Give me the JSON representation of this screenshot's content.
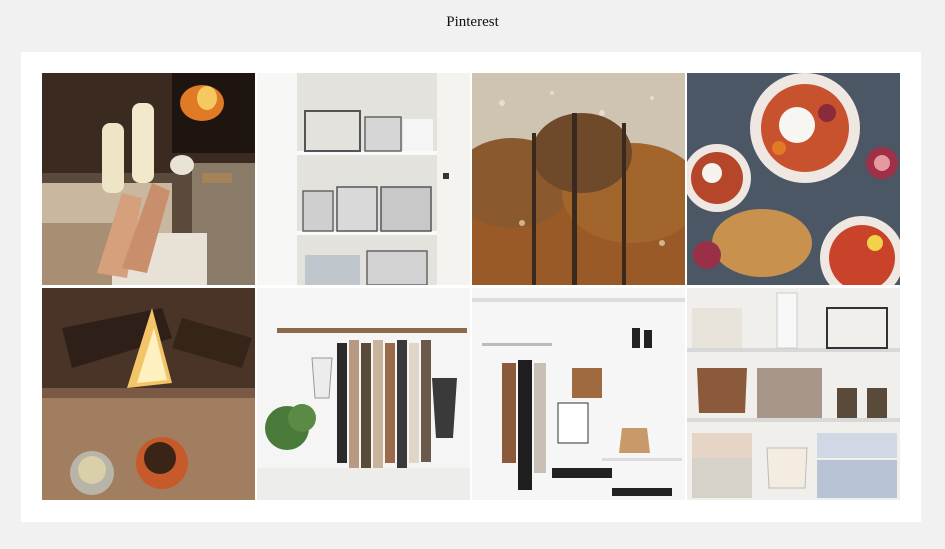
{
  "page": {
    "title": "Pinterest"
  },
  "gallery": {
    "tiles": [
      {
        "name": "cozy-fireplace-socks-photo",
        "row": 0,
        "col": 0
      },
      {
        "name": "closet-wire-baskets-photo",
        "row": 0,
        "col": 1
      },
      {
        "name": "rainy-window-autumn-trees-photo",
        "row": 0,
        "col": 2
      },
      {
        "name": "figs-burrata-salad-bowls-photo",
        "row": 0,
        "col": 3
      },
      {
        "name": "campfire-hot-drinks-photo",
        "row": 1,
        "col": 0
      },
      {
        "name": "branch-clothing-rack-photo",
        "row": 1,
        "col": 1
      },
      {
        "name": "minimal-wardrobe-shoes-bags-photo",
        "row": 1,
        "col": 2
      },
      {
        "name": "shelves-folded-sweaters-photo",
        "row": 1,
        "col": 3
      }
    ]
  },
  "colors": {
    "page_background": "#f1f1f1",
    "card_background": "#ffffff"
  }
}
